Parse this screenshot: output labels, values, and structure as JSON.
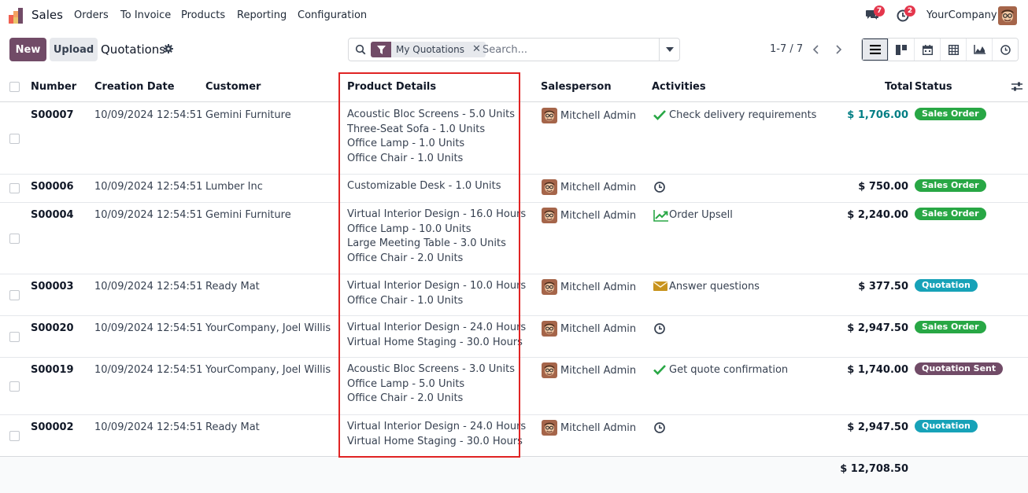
{
  "app": {
    "name": "Sales"
  },
  "menu": [
    "Orders",
    "To Invoice",
    "Products",
    "Reporting",
    "Configuration"
  ],
  "navbar": {
    "messages_count": "7",
    "activities_count": "2",
    "company": "YourCompany"
  },
  "control": {
    "new_label": "New",
    "upload_label": "Upload",
    "title": "Quotations",
    "facet": "My Quotations",
    "search_placeholder": "Search...",
    "pager": "1-7 / 7"
  },
  "columns": {
    "number": "Number",
    "creation_date": "Creation Date",
    "customer": "Customer",
    "product_details": "Product Details",
    "salesperson": "Salesperson",
    "activities": "Activities",
    "total": "Total",
    "status": "Status"
  },
  "rows": [
    {
      "number": "S00007",
      "date": "10/09/2024 12:54:51",
      "customer": "Gemini Furniture",
      "products": [
        "Acoustic Bloc Screens - 5.0 Units",
        "Three-Seat Sofa - 1.0 Units",
        "Office Lamp - 1.0 Units",
        "Office Chair - 1.0 Units"
      ],
      "salesperson": "Mitchell Admin",
      "activity_icon": "check-icon",
      "activity": "Check delivery requirements",
      "total": "$ 1,706.00",
      "status": "Sales Order"
    },
    {
      "number": "S00006",
      "date": "10/09/2024 12:54:51",
      "customer": "Lumber Inc",
      "products": [
        "Customizable Desk - 1.0 Units"
      ],
      "salesperson": "Mitchell Admin",
      "activity_icon": "clock-icon",
      "activity": "",
      "total": "$ 750.00",
      "status": "Sales Order"
    },
    {
      "number": "S00004",
      "date": "10/09/2024 12:54:51",
      "customer": "Gemini Furniture",
      "products": [
        "Virtual Interior Design - 16.0 Hours",
        "Office Lamp - 10.0 Units",
        "Large Meeting Table - 3.0 Units",
        "Office Chair - 2.0 Units"
      ],
      "salesperson": "Mitchell Admin",
      "activity_icon": "trend-up-icon",
      "activity": "Order Upsell",
      "total": "$ 2,240.00",
      "status": "Sales Order"
    },
    {
      "number": "S00003",
      "date": "10/09/2024 12:54:51",
      "customer": "Ready Mat",
      "products": [
        "Virtual Interior Design - 10.0 Hours",
        "Office Chair - 1.0 Units"
      ],
      "salesperson": "Mitchell Admin",
      "activity_icon": "envelope-icon",
      "activity": "Answer questions",
      "total": "$ 377.50",
      "status": "Quotation"
    },
    {
      "number": "S00020",
      "date": "10/09/2024 12:54:51",
      "customer": "YourCompany, Joel Willis",
      "products": [
        "Virtual Interior Design - 24.0 Hours",
        "Virtual Home Staging - 30.0 Hours"
      ],
      "salesperson": "Mitchell Admin",
      "activity_icon": "clock-icon",
      "activity": "",
      "total": "$ 2,947.50",
      "status": "Sales Order"
    },
    {
      "number": "S00019",
      "date": "10/09/2024 12:54:51",
      "customer": "YourCompany, Joel Willis",
      "products": [
        "Acoustic Bloc Screens - 3.0 Units",
        "Office Lamp - 5.0 Units",
        "Office Chair - 2.0 Units"
      ],
      "salesperson": "Mitchell Admin",
      "activity_icon": "check-icon",
      "activity": "Get quote confirmation",
      "total": "$ 1,740.00",
      "status": "Quotation Sent"
    },
    {
      "number": "S00002",
      "date": "10/09/2024 12:54:51",
      "customer": "Ready Mat",
      "products": [
        "Virtual Interior Design - 24.0 Hours",
        "Virtual Home Staging - 30.0 Hours"
      ],
      "salesperson": "Mitchell Admin",
      "activity_icon": "clock-icon",
      "activity": "",
      "total": "$ 2,947.50",
      "status": "Quotation"
    }
  ],
  "grand_total": "$ 12,708.50",
  "colors": {
    "primary": "#714b67",
    "sales_order": "#28a745",
    "quotation": "#17a2b8",
    "quotation_sent": "#714b67",
    "highlight": "#e02424"
  }
}
